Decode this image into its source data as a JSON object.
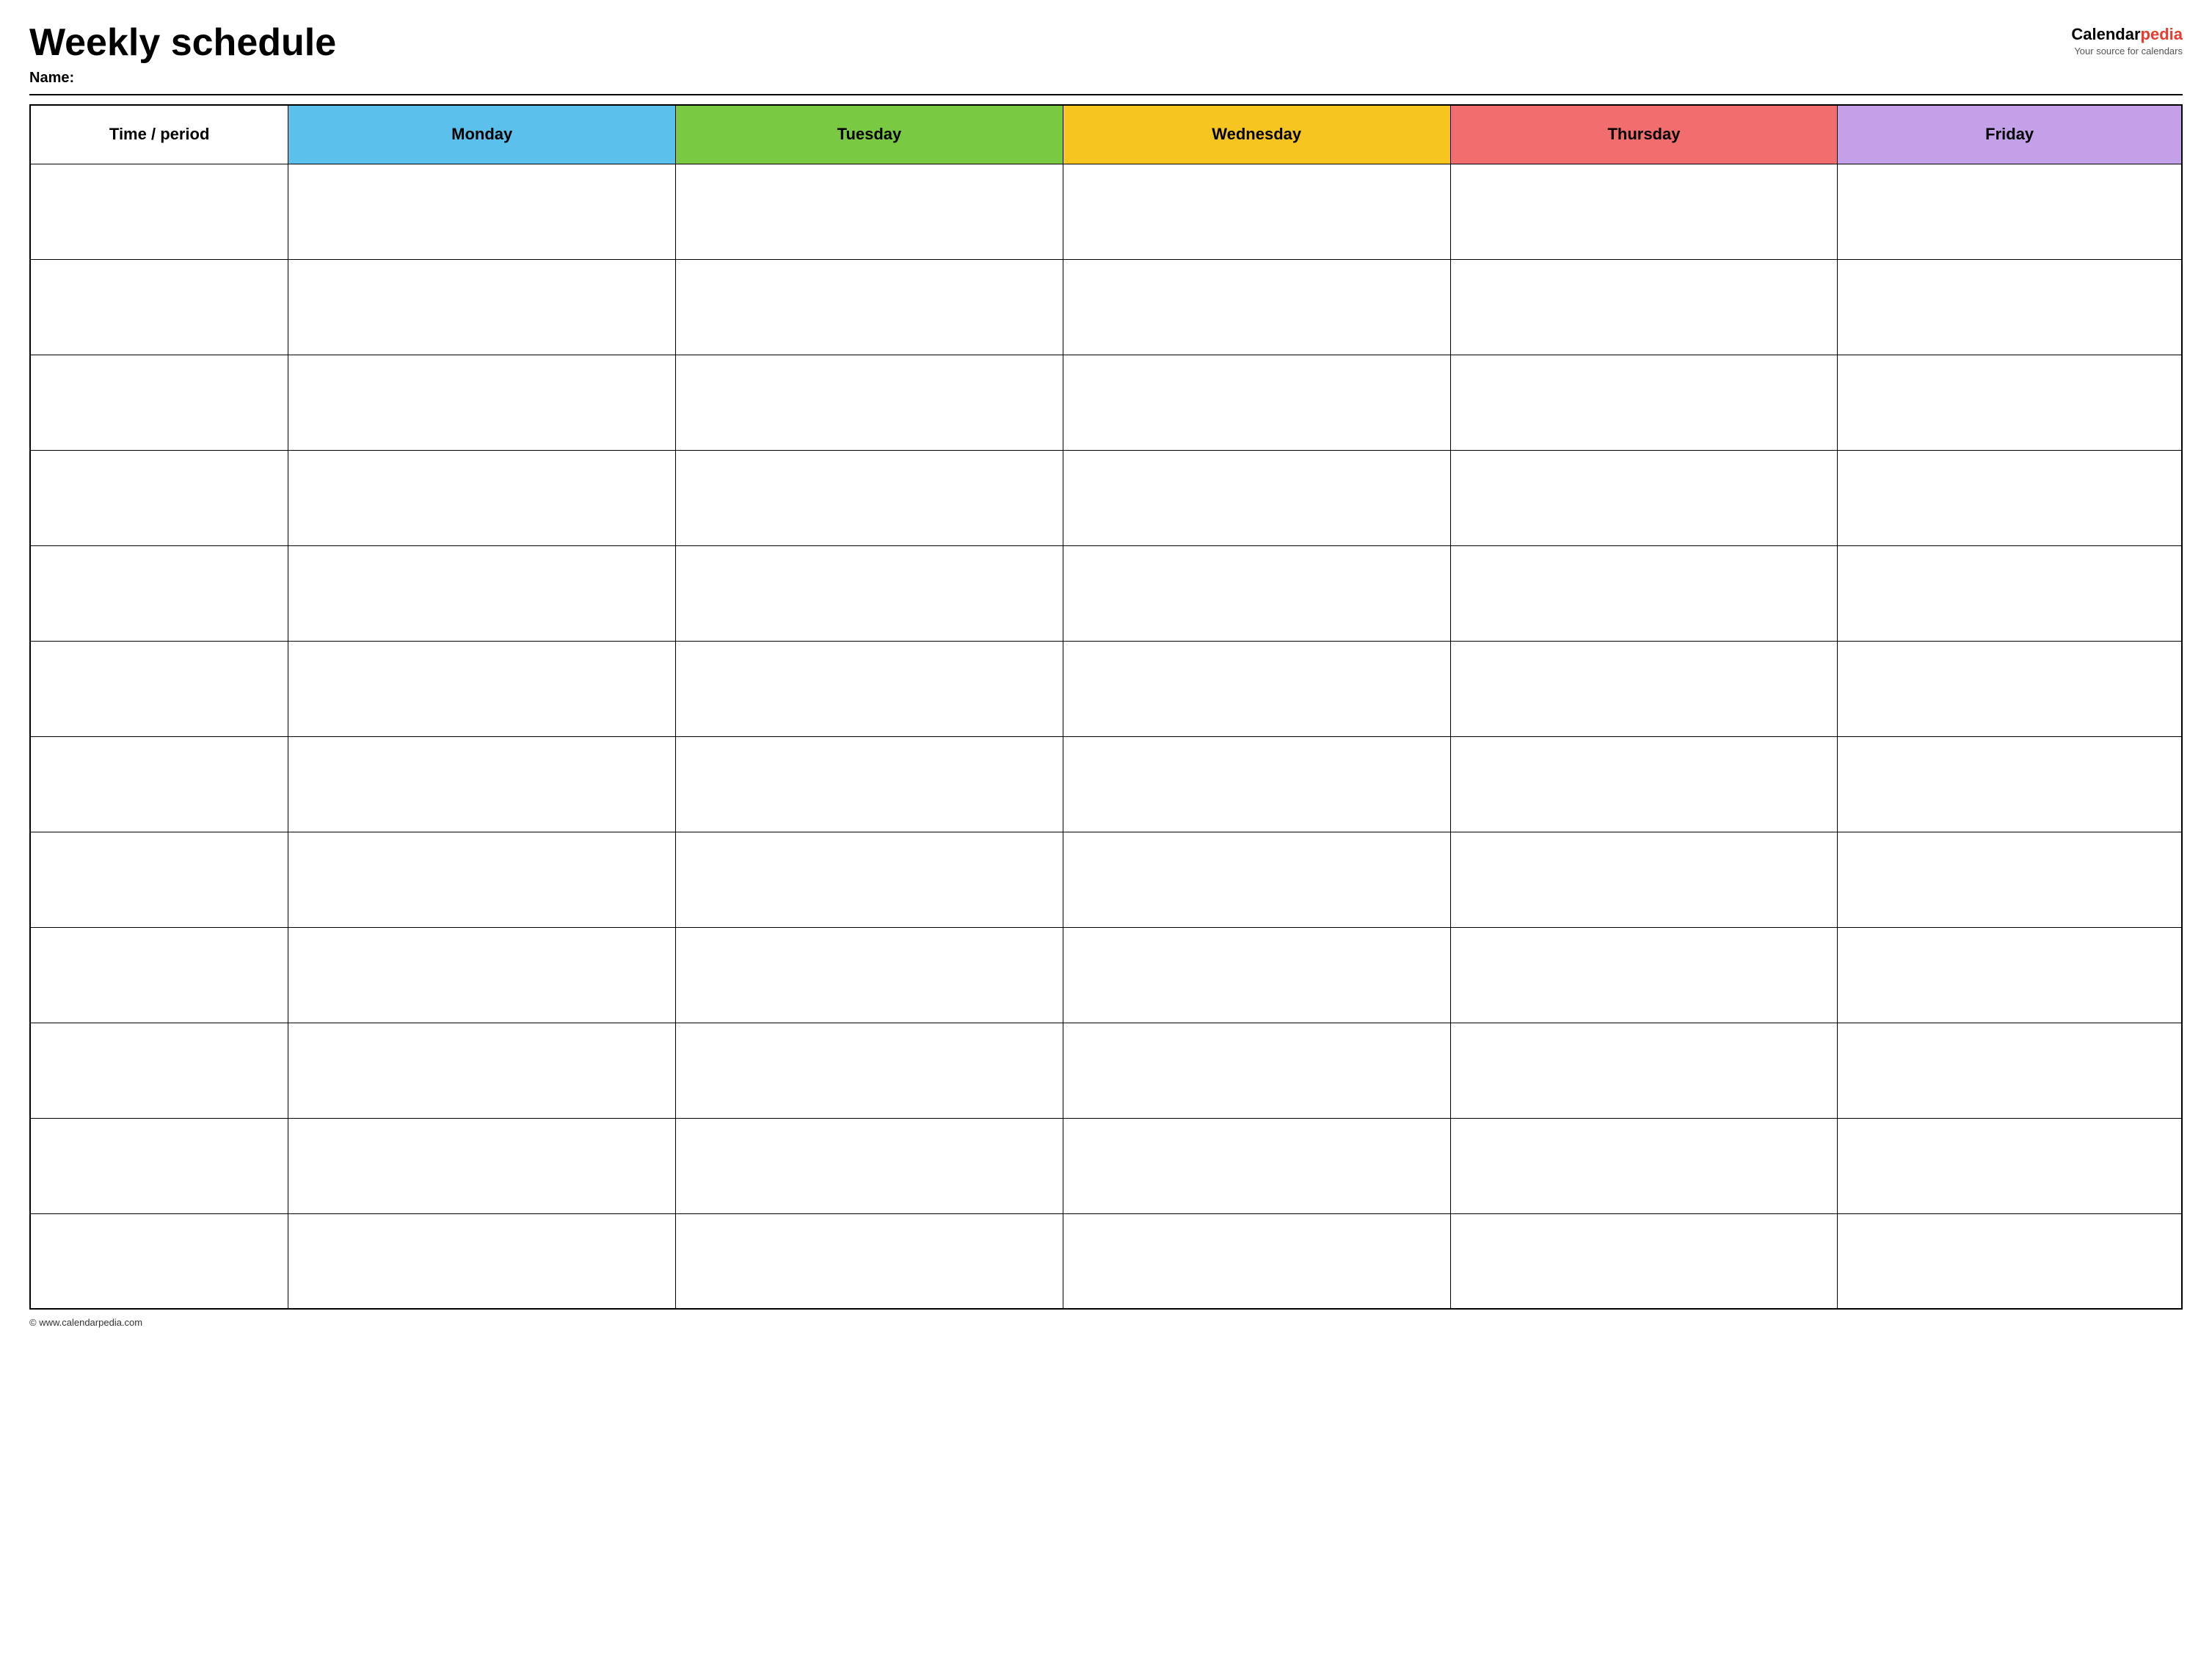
{
  "header": {
    "title": "Weekly schedule",
    "name_label": "Name:",
    "logo": {
      "calendar": "Calendar",
      "pedia": "pedia",
      "tagline": "Your source for calendars"
    }
  },
  "table": {
    "columns": [
      {
        "id": "time",
        "label": "Time / period",
        "class": "th-time"
      },
      {
        "id": "monday",
        "label": "Monday",
        "class": "th-monday"
      },
      {
        "id": "tuesday",
        "label": "Tuesday",
        "class": "th-tuesday"
      },
      {
        "id": "wednesday",
        "label": "Wednesday",
        "class": "th-wednesday"
      },
      {
        "id": "thursday",
        "label": "Thursday",
        "class": "th-thursday"
      },
      {
        "id": "friday",
        "label": "Friday",
        "class": "th-friday"
      }
    ],
    "row_count": 12
  },
  "footer": {
    "text": "© www.calendarpedia.com"
  }
}
